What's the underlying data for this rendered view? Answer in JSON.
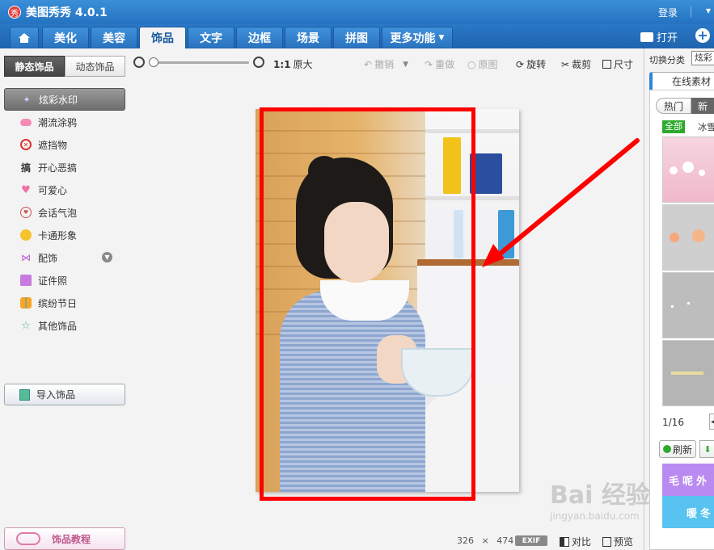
{
  "app": {
    "logo_text": "秀",
    "title": "美图秀秀 4.0.1",
    "login_label": "登录"
  },
  "main_tabs": [
    {
      "label": "美化"
    },
    {
      "label": "美容"
    },
    {
      "label": "饰品",
      "active": true
    },
    {
      "label": "文字"
    },
    {
      "label": "边框"
    },
    {
      "label": "场景"
    },
    {
      "label": "拼图"
    },
    {
      "label": "更多功能"
    }
  ],
  "header_actions": {
    "open_label": "打开",
    "new_icon": "plus-circle-icon"
  },
  "sidebar": {
    "tabs": [
      {
        "label": "静态饰品",
        "active": true
      },
      {
        "label": "动态饰品"
      }
    ],
    "categories": [
      {
        "label": "炫彩水印",
        "active": true,
        "icon": "sparkle-icon"
      },
      {
        "label": "潮流涂鸦",
        "icon": "lips-icon"
      },
      {
        "label": "遮挡物",
        "icon": "no-entry-icon"
      },
      {
        "label": "开心恶搞",
        "icon": "gao-glyph-icon",
        "icon_glyph": "搞"
      },
      {
        "label": "可爱心",
        "icon": "heart-icon"
      },
      {
        "label": "会话气泡",
        "icon": "speech-bubble-icon"
      },
      {
        "label": "卡通形象",
        "icon": "cartoon-face-icon"
      },
      {
        "label": "配饰",
        "icon": "bow-icon",
        "expandable": true
      },
      {
        "label": "证件照",
        "icon": "shirt-icon"
      },
      {
        "label": "缤纷节日",
        "icon": "gift-icon"
      },
      {
        "label": "其他饰品",
        "icon": "star-outline-icon"
      }
    ],
    "import_label": "导入饰品",
    "tutorial_label": "饰品教程"
  },
  "toolbar": {
    "zoom_level": 0,
    "ratio_label": "1:1",
    "original_size_label": "原大",
    "undo_label": "撤销",
    "redo_label": "重做",
    "original_image_label": "原图",
    "rotate_label": "旋转",
    "crop_label": "裁剪",
    "resize_label": "尺寸"
  },
  "status": {
    "width": "326",
    "times": "×",
    "height": "474",
    "exif_label": "EXIF",
    "compare_label": "对比",
    "preview_label": "预览"
  },
  "right_panel": {
    "switch_label": "切换分类",
    "switch_value": "炫彩",
    "online_tab_label": "在线素材",
    "hot_label": "热门",
    "new_label": "新",
    "all_chip": "全部",
    "ice_chip": "冰雪",
    "page_label": "1/16",
    "prev_icon": "chevron-left-icon",
    "refresh_label": "刷新",
    "banner1_text": "毛呢外",
    "banner2_text": "暖冬"
  },
  "watermark": {
    "main": "Bai 经验",
    "sub": "jingyan.baidu.com"
  },
  "colors": {
    "titlebar": "#2472c0",
    "annotation_red": "#ff0000",
    "active_green": "#2daa2d"
  }
}
